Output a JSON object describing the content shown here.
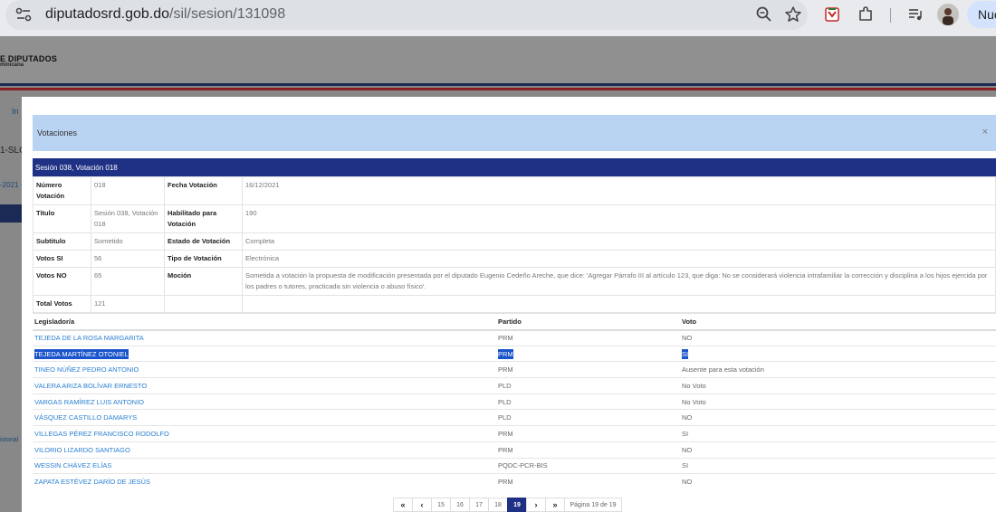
{
  "browser": {
    "url_domain": "diputadosrd.gob.do",
    "url_path": "/sil/sesion/131098",
    "new_tab_label": "Nue"
  },
  "site": {
    "logo_title": "E DIPUTADOS",
    "logo_subtitle": "minicana",
    "bg_fragments": [
      "In",
      "1-SLO",
      "-2021 -",
      "istorial"
    ]
  },
  "modal": {
    "title": "Votaciones",
    "close_label": "×",
    "session_header": "Sesión 038, Votación 018",
    "details": [
      {
        "label": "Número Votación",
        "value": "018",
        "label2": "Fecha Votación",
        "value2": "16/12/2021"
      },
      {
        "label": "Titulo",
        "value": "Sesión 038, Votación 018",
        "label2": "Habilitado para Votación",
        "value2": "190"
      },
      {
        "label": "Subtitulo",
        "value": "Sometido",
        "label2": "Estado de Votación",
        "value2": "Completa"
      },
      {
        "label": "Votos SI",
        "value": "56",
        "label2": "Tipo de Votación",
        "value2": "Electrónica"
      },
      {
        "label": "Votos NO",
        "value": "65",
        "label2": "Moción",
        "value2": "Sometida a votación la propuesta de modificación presentada por el diputado Eugenio Cedeño Areche, que dice: 'Agregar Párrafo III al artículo 123, que diga: No se considerará violencia intrafamiliar la corrección y disciplina a los hijos ejercida por los padres o tutores, practicada sin violencia o abuso físico'."
      },
      {
        "label": "Total Votos",
        "value": "121",
        "label2": "",
        "value2": ""
      }
    ],
    "votes_table": {
      "headers": [
        "Legislador/a",
        "Partido",
        "Voto"
      ],
      "rows": [
        {
          "name": "TEJEDA DE LA ROSA MARGARITA",
          "party": "PRM",
          "vote": "NO"
        },
        {
          "name": "TEJEDA MARTÍNEZ OTONIEL",
          "party": "PRM",
          "vote": "SI"
        },
        {
          "name": "TINEO NÚÑEZ PEDRO ANTONIO",
          "party": "PRM",
          "vote": "Ausente para esta votación"
        },
        {
          "name": "VALERA ARIZA BOLÍVAR ERNESTO",
          "party": "PLD",
          "vote": "No Voto"
        },
        {
          "name": "VARGAS RAMÍREZ LUIS ANTONIO",
          "party": "PLD",
          "vote": "No Voto"
        },
        {
          "name": "VÁSQUEZ CASTILLO DAMARYS",
          "party": "PLD",
          "vote": "NO"
        },
        {
          "name": "VILLEGAS PÉREZ FRANCISCO RODOLFO",
          "party": "PRM",
          "vote": "SI"
        },
        {
          "name": "VILORIO LIZARDO SANTIAGO",
          "party": "PRM",
          "vote": "NO"
        },
        {
          "name": "WESSIN CHÁVEZ ELÍAS",
          "party": "PQDC-PCR-BIS",
          "vote": "SI"
        },
        {
          "name": "ZAPATA ESTÉVEZ DARÍO DE JESÚS",
          "party": "PRM",
          "vote": "NO"
        }
      ]
    },
    "pager": {
      "first": "«",
      "prev": "‹",
      "pages": [
        "15",
        "16",
        "17",
        "18",
        "19"
      ],
      "current": "19",
      "next": "›",
      "last": "»",
      "info": "Página 19 de 19"
    }
  }
}
